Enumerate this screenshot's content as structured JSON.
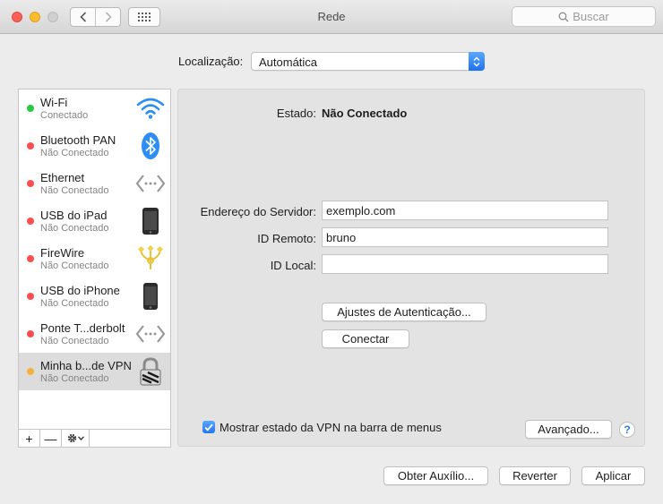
{
  "window": {
    "title": "Rede"
  },
  "search": {
    "placeholder": "Buscar"
  },
  "location": {
    "label": "Localização:",
    "value": "Automática"
  },
  "services": [
    {
      "name": "Wi-Fi",
      "status": "Conectado",
      "dot_color": "#27c93f",
      "icon": "wifi-icon"
    },
    {
      "name": "Bluetooth PAN",
      "status": "Não Conectado",
      "dot_color": "#fc4e4e",
      "icon": "bluetooth-icon"
    },
    {
      "name": "Ethernet",
      "status": "Não Conectado",
      "dot_color": "#fc4e4e",
      "icon": "ethernet-icon"
    },
    {
      "name": "USB do iPad",
      "status": "Não Conectado",
      "dot_color": "#fc4e4e",
      "icon": "ipad-icon"
    },
    {
      "name": "FireWire",
      "status": "Não Conectado",
      "dot_color": "#fc4e4e",
      "icon": "firewire-icon"
    },
    {
      "name": "USB do iPhone",
      "status": "Não Conectado",
      "dot_color": "#fc4e4e",
      "icon": "iphone-icon"
    },
    {
      "name": "Ponte T...derbolt",
      "status": "Não Conectado",
      "dot_color": "#fc4e4e",
      "icon": "thunderbolt-bridge-icon"
    },
    {
      "name": "Minha b...de VPN",
      "status": "Não Conectado",
      "dot_color": "#f5b13c",
      "icon": "vpn-lock-icon",
      "selected": true
    }
  ],
  "sidebar_tools": {
    "add": "+",
    "remove": "—"
  },
  "detail": {
    "status_label": "Estado:",
    "status_value": "Não Conectado",
    "server_label": "Endereço do Servidor:",
    "server_value": "exemplo.com",
    "remote_id_label": "ID Remoto:",
    "remote_id_value": "bruno",
    "local_id_label": "ID Local:",
    "local_id_value": "",
    "auth_button": "Ajustes de Autenticação...",
    "connect_button": "Conectar",
    "show_vpn_label": "Mostrar estado da VPN na barra de menus",
    "show_vpn_checked": true,
    "advanced_button": "Avançado...",
    "help": "?"
  },
  "footer": {
    "help_button": "Obter Auxílio...",
    "revert_button": "Reverter",
    "apply_button": "Aplicar"
  },
  "colors": {
    "accent": "#2176ee",
    "connected": "#27c93f",
    "disconnected": "#fc4e4e",
    "inactive": "#f5b13c"
  }
}
